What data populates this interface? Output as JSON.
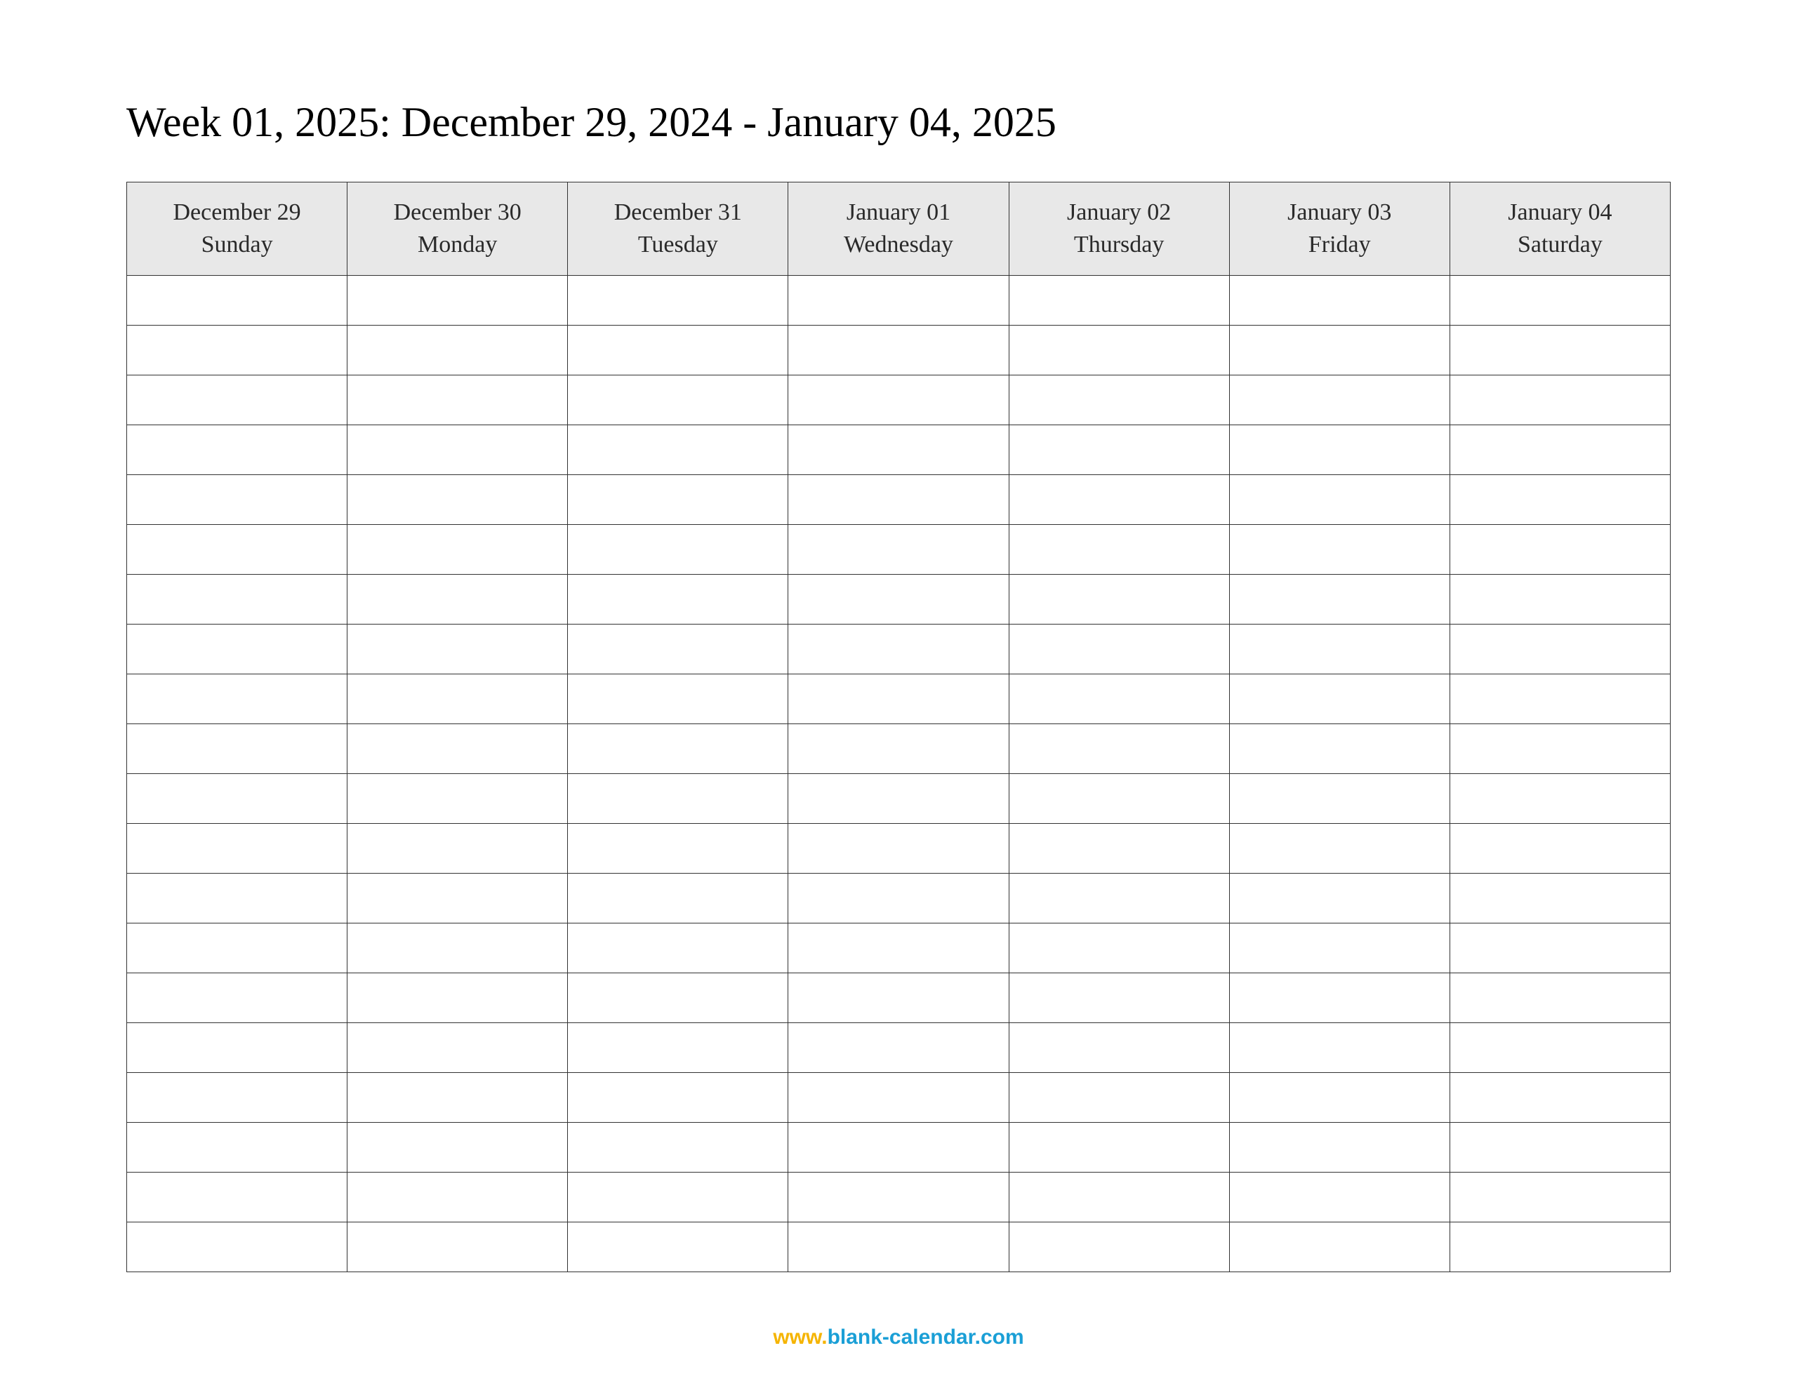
{
  "title": "Week 01, 2025: December 29, 2024 - January 04, 2025",
  "columns": [
    {
      "date": "December 29",
      "day": "Sunday"
    },
    {
      "date": "December 30",
      "day": "Monday"
    },
    {
      "date": "December 31",
      "day": "Tuesday"
    },
    {
      "date": "January 01",
      "day": "Wednesday"
    },
    {
      "date": "January 02",
      "day": "Thursday"
    },
    {
      "date": "January 03",
      "day": "Friday"
    },
    {
      "date": "January 04",
      "day": "Saturday"
    }
  ],
  "row_count": 20,
  "footer": {
    "prefix": "www.",
    "domain": "blank-calendar.com"
  }
}
